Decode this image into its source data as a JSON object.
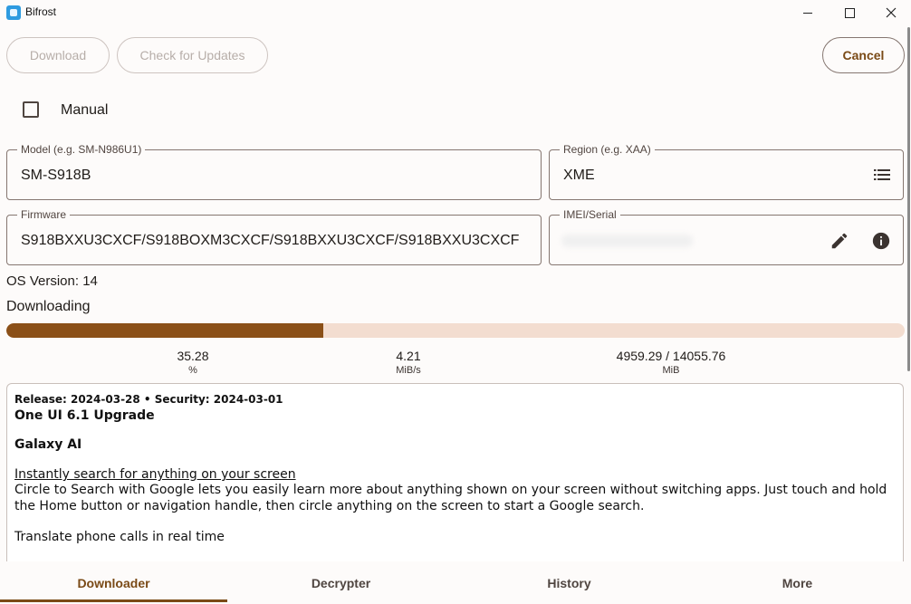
{
  "window": {
    "title": "Bifrost"
  },
  "toolbar": {
    "download_label": "Download",
    "check_updates_label": "Check for Updates",
    "cancel_label": "Cancel"
  },
  "manual": {
    "label": "Manual",
    "checked": false
  },
  "fields": {
    "model": {
      "label": "Model (e.g. SM-N986U1)",
      "value": "SM-S918B"
    },
    "region": {
      "label": "Region (e.g. XAA)",
      "value": "XME"
    },
    "firmware": {
      "label": "Firmware",
      "value": "S918BXXU3CXCF/S918BOXM3CXCF/S918BXXU3CXCF/S918BXXU3CXCF"
    },
    "imei": {
      "label": "IMEI/Serial",
      "value": ""
    }
  },
  "os_version": "OS Version: 14",
  "status": "Downloading",
  "progress": {
    "fraction": 0.3528
  },
  "stats": {
    "percent": {
      "value": "35.28",
      "unit": "%"
    },
    "speed": {
      "value": "4.21",
      "unit": "MiB/s"
    },
    "size": {
      "value": "4959.29 / 14055.76",
      "unit": "MiB"
    }
  },
  "notes": {
    "release_line": "Release: 2024-03-28  •  Security: 2024-03-01",
    "title": "One UI 6.1 Upgrade",
    "section": "Galaxy AI",
    "feature1_title": "Instantly search for anything on your screen",
    "feature1_body": "Circle to Search with Google lets you easily learn more about anything shown on your screen without switching apps. Just touch and hold the Home button or navigation handle, then circle anything on the screen to start a Google search.",
    "feature2_title": "Translate phone calls in real time"
  },
  "nav": {
    "tabs": [
      "Downloader",
      "Decrypter",
      "History",
      "More"
    ],
    "active": "Downloader"
  },
  "colors": {
    "accent": "#7a4a16",
    "progress_fill": "#8b5018",
    "progress_track": "#f3ddd0"
  }
}
